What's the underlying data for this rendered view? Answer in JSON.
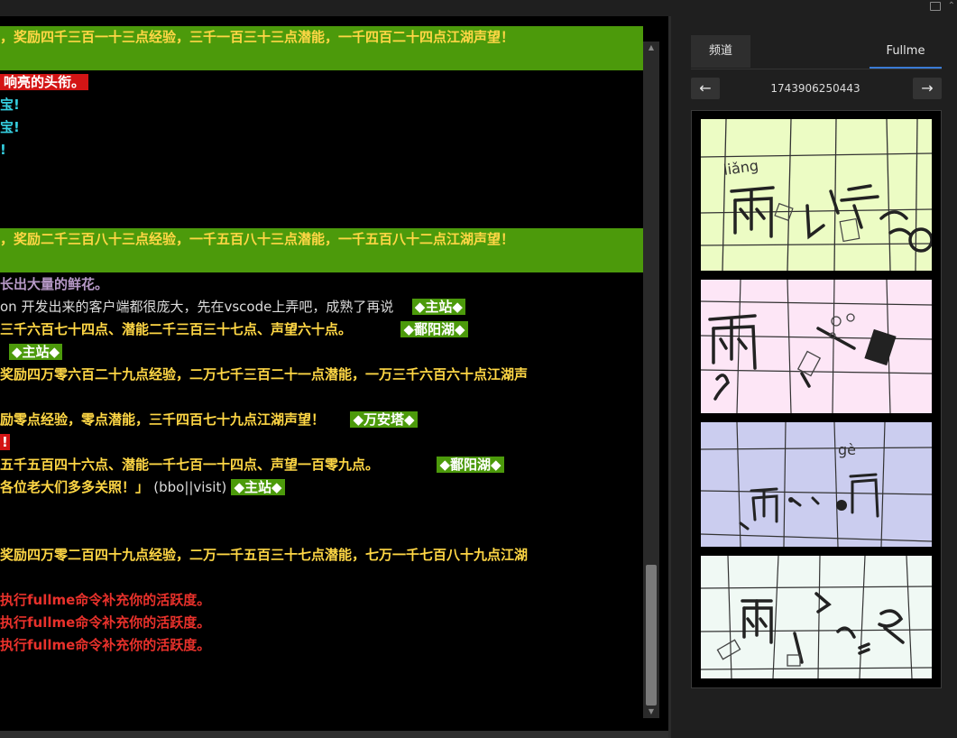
{
  "terminal": {
    "line1": "，奖励四千三百一十三点经验，三千一百三十三点潜能，一千四百二十四点江湖声望！",
    "line2": "响亮的头衔。",
    "line3": "宝!",
    "line4": "宝!",
    "line5": "!",
    "line6": "，奖励二千三百八十三点经验，一千五百八十三点潜能，一千五百八十二点江湖声望！",
    "line7": "长出大量的鲜花。",
    "line8": "on 开发出来的客户端都很庞大，先在vscode上弄吧，成熟了再说",
    "line8_tag": "◆主站◆",
    "line9": "三千六百七十四点、潜能二千三百三十七点、声望六十点。",
    "line9_tag": "◆鄱阳湖◆",
    "line10_tag": "◆主站◆",
    "line11": "奖励四万零六百二十九点经验，二万七千三百二十一点潜能，一万三千六百六十点江湖声",
    "line12": "励零点经验，零点潜能，三千四百七十九点江湖声望！",
    "line12_tag": "◆万安塔◆",
    "line13": "!",
    "line14": "五千五百四十六点、潜能一千七百一十四点、声望一百零九点。",
    "line14_tag": "◆鄱阳湖◆",
    "line15a": "各位老大们多多关照！」",
    "line15b": "(bbo||visit)",
    "line15_tag": "◆主站◆",
    "line16": "奖励四万零二百四十九点经验，二万一千五百三十七点潜能，七万一千七百八十九点江湖",
    "line17": "执行fullme命令补充你的活跃度。",
    "line18": "执行fullme命令补充你的活跃度。",
    "line19": "执行fullme命令补充你的活跃度。"
  },
  "panel": {
    "tab_channel": "频道",
    "tab_fullme": "Fullme",
    "prev": "←",
    "next": "→",
    "captcha_id": "1743906250443"
  },
  "captchas": [
    {
      "bg": "#ecfcc4",
      "pinyin": "liǎng"
    },
    {
      "bg": "#fde6f6",
      "pinyin": ""
    },
    {
      "bg": "#cbcdef",
      "pinyin": "gè"
    },
    {
      "bg": "#f0f9f4",
      "pinyin": ""
    }
  ],
  "colors": {
    "band_green": "#4c9a0b",
    "yellow_text": "#ffd745",
    "red_text": "#e8312b",
    "accent_blue": "#3a7bd5"
  }
}
